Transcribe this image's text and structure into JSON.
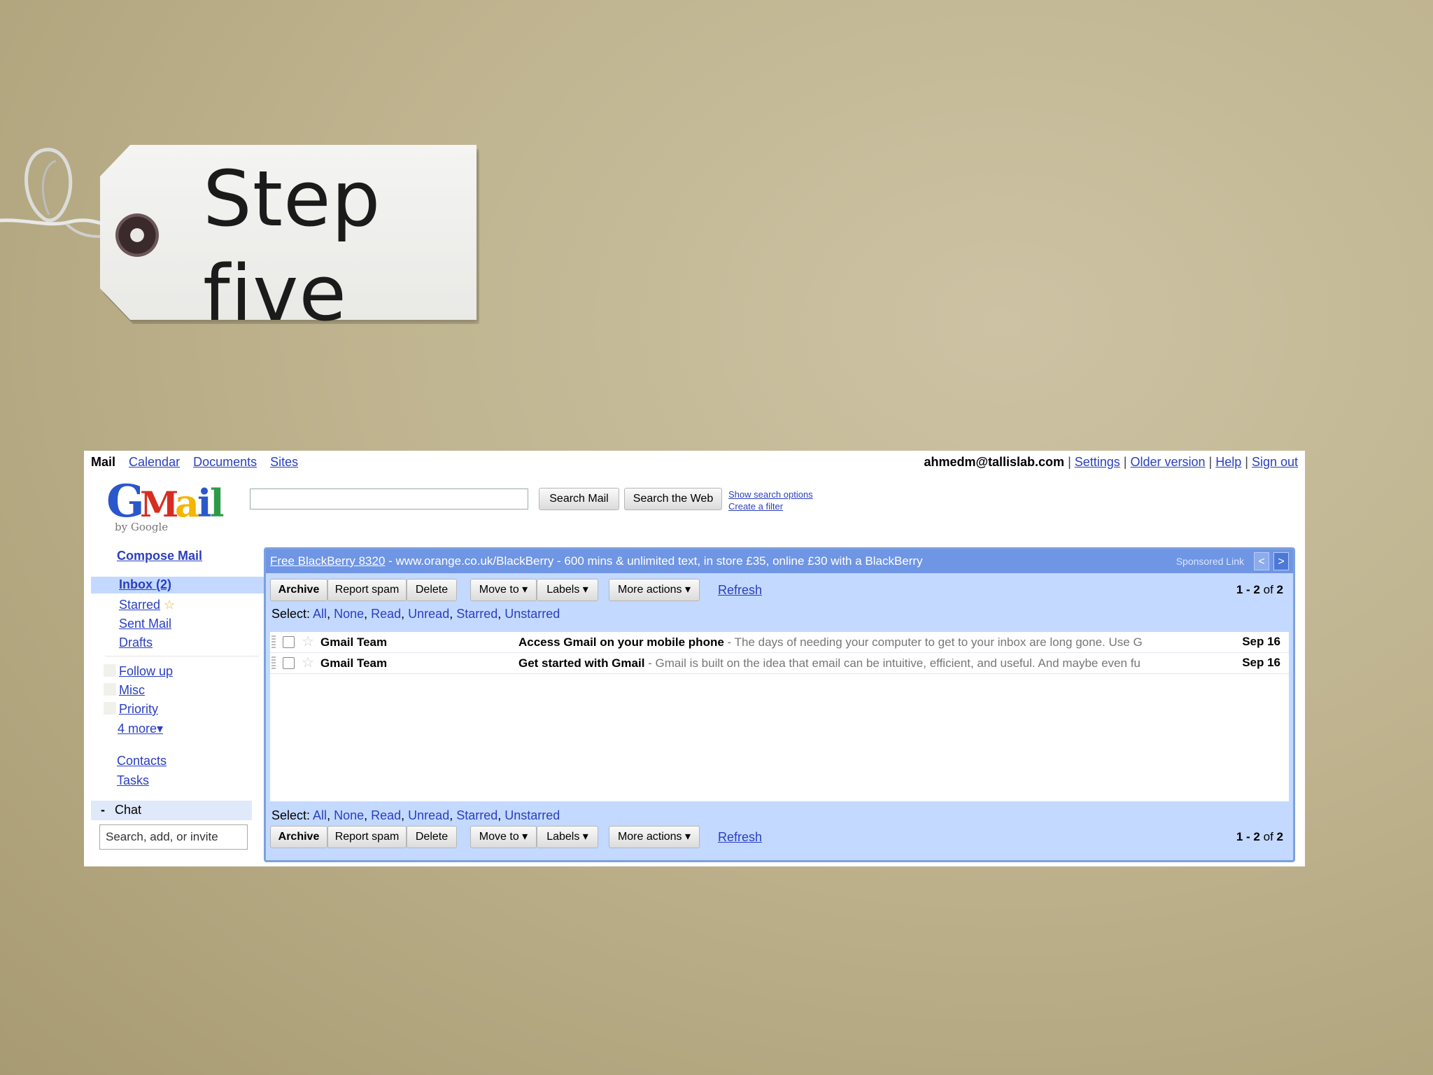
{
  "tag": {
    "line1": "Step",
    "line2": "five"
  },
  "topbar": {
    "apps": [
      "Mail",
      "Calendar",
      "Documents",
      "Sites"
    ],
    "account": "ahmedm@tallislab.com",
    "links": [
      "Settings",
      "Older version",
      "Help",
      "Sign out"
    ]
  },
  "logo": {
    "text": "Gmail",
    "by": "by Google"
  },
  "search": {
    "value": "",
    "search_mail": "Search Mail",
    "search_web": "Search the Web",
    "show_options": "Show search options",
    "create_filter": "Create a filter"
  },
  "nav": {
    "compose": "Compose Mail",
    "inbox": "Inbox (2)",
    "starred": "Starred",
    "sent": "Sent Mail",
    "drafts": "Drafts",
    "labels": [
      "Follow up",
      "Misc",
      "Priority"
    ],
    "more": "4 more▾",
    "contacts": "Contacts",
    "tasks": "Tasks",
    "chat": "Chat",
    "chat_collapse": "-",
    "chat_placeholder": "Search, add, or invite"
  },
  "ad": {
    "link": "Free BlackBerry 8320",
    "text": " - www.orange.co.uk/BlackBerry - 600 mins & unlimited text, in store £35, online £30 with a BlackBerry",
    "sponsored": "Sponsored Link",
    "prev": "<",
    "next": ">"
  },
  "toolbar": {
    "archive": "Archive",
    "report_spam": "Report spam",
    "delete": "Delete",
    "move_to": "Move to ▾",
    "labels": "Labels ▾",
    "more_actions": "More actions ▾",
    "refresh": "Refresh",
    "count_prefix": "1 - 2",
    "count_of": " of ",
    "count_total": "2"
  },
  "select": {
    "label": "Select: ",
    "options": [
      "All",
      "None",
      "Read",
      "Unread",
      "Starred",
      "Unstarred"
    ]
  },
  "emails": [
    {
      "sender": "Gmail Team",
      "subject": "Access Gmail on your mobile phone",
      "snippet": " - The days of needing your computer to get to your inbox are long gone. Use G",
      "date": "Sep 16"
    },
    {
      "sender": "Gmail Team",
      "subject": "Get started with Gmail",
      "snippet": " - Gmail is built on the idea that email can be intuitive, efficient, and useful. And maybe even fu",
      "date": "Sep 16"
    }
  ],
  "colors": {
    "panel_blue": "#c3d9ff",
    "ad_blue": "#6f95e5",
    "link": "#2a3fc0"
  }
}
